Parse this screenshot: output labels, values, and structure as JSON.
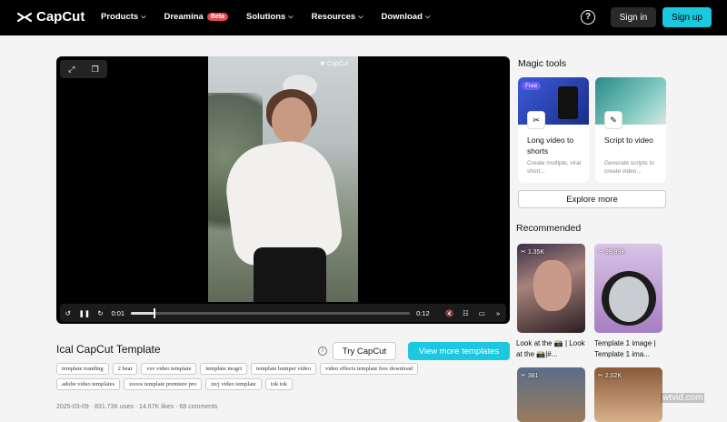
{
  "nav": {
    "logo": "CapCut",
    "items": [
      {
        "label": "Products",
        "chevron": true
      },
      {
        "label": "Dreamina",
        "badge": "Beta",
        "chevron": false
      },
      {
        "label": "Solutions",
        "chevron": true
      },
      {
        "label": "Resources",
        "chevron": true
      },
      {
        "label": "Download",
        "chevron": true
      }
    ],
    "sign_in": "Sign in",
    "sign_up": "Sign up"
  },
  "player": {
    "watermark": "CapCut",
    "current_time": "0:01",
    "duration": "0:12",
    "progress": 0.08
  },
  "template": {
    "title": "Ical CapCut Template",
    "try_label": "Try CapCut",
    "view_label": "View more templates",
    "tags": [
      "template tranding",
      "2 beat",
      "vsv video template",
      "template mogrt",
      "template bumper video",
      "video effects template free download",
      "adobe video templates",
      "zooos template premiere pro",
      "tzcj video template",
      "tok tok"
    ],
    "meta": "2025-03-09 · 831.73K uses · 14.67K likes · 68 comments"
  },
  "sidebar": {
    "magic_title": "Magic tools",
    "tools": [
      {
        "badge": "Free",
        "title": "Long video to shorts",
        "desc": "Create multiple, viral short..."
      },
      {
        "badge": "",
        "title": "Script to video",
        "desc": "Generate scripts to create video..."
      }
    ],
    "explore_label": "Explore more",
    "recommended_title": "Recommended",
    "recommended": [
      {
        "stat": "1.35K",
        "title": "Look at the 📸 | Look at the 📸|#..."
      },
      {
        "stat": "99.99K",
        "title": "Template 1 image | Template 1 ima..."
      },
      {
        "stat": "381",
        "title": ""
      },
      {
        "stat": "2.02K",
        "title": ""
      }
    ]
  },
  "site_watermark": "wtvid.com",
  "colors": {
    "accent": "#1bc8e0",
    "nav_bg": "#000000",
    "beta": "#e5484d"
  }
}
